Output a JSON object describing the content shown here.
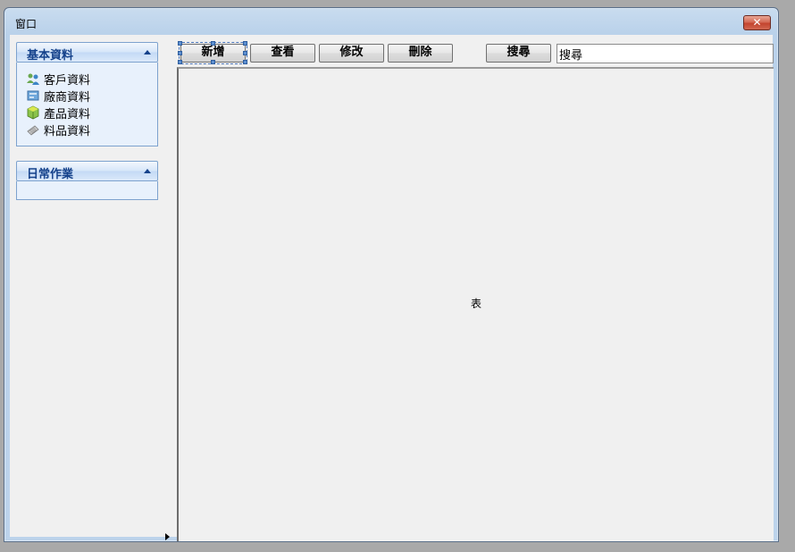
{
  "window": {
    "title": "窗口",
    "close_glyph": "✕"
  },
  "nav": {
    "groups": [
      {
        "title": "基本資料",
        "items": [
          {
            "label": "客戶資料",
            "icon": "users-icon"
          },
          {
            "label": "廠商資料",
            "icon": "vendor-icon"
          },
          {
            "label": "產品資料",
            "icon": "product-box-icon"
          },
          {
            "label": "料品資料",
            "icon": "material-icon"
          }
        ]
      },
      {
        "title": "日常作業",
        "items": []
      }
    ]
  },
  "toolbar": {
    "add_label": "新增",
    "view_label": "查看",
    "edit_label": "修改",
    "delete_label": "刪除",
    "search_label": "搜尋",
    "search_value": "搜尋"
  },
  "main": {
    "table_placeholder": "表"
  },
  "colors": {
    "accent": "#15428b",
    "close": "#c4452f"
  }
}
